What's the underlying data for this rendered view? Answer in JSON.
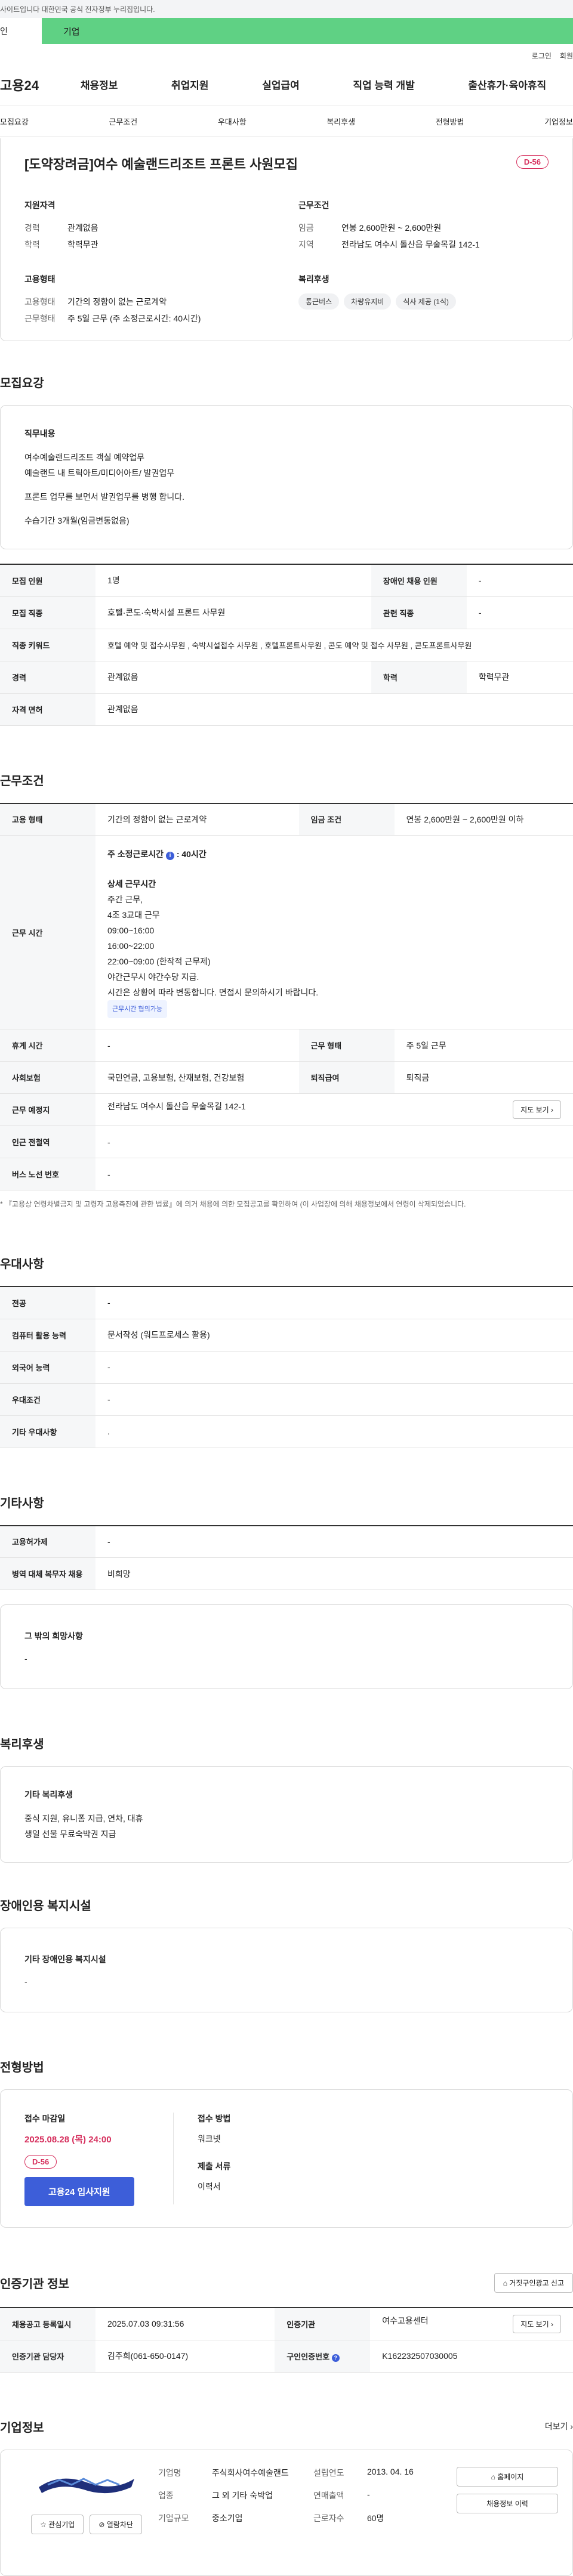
{
  "gov_bar": "사이트입니다 대한민국 공식 전자정부 누리집입니다.",
  "top_tabs": {
    "individual": "인",
    "company": "기업"
  },
  "util": {
    "login": "로그인",
    "join": "회원"
  },
  "logo": "고용24",
  "gnb": [
    "채용정보",
    "취업지원",
    "실업급여",
    "직업 능력 개발",
    "출산휴가·육아휴직"
  ],
  "subnav": [
    "모집요강",
    "근무조건",
    "우대사항",
    "복리후생",
    "전형방법",
    "기업정보"
  ],
  "summary": {
    "title": "[도약장려금]여수 예술랜드리조트 프론트 사원모집",
    "dday": "D-56",
    "qualification": {
      "title": "지원자격",
      "career_k": "경력",
      "career_v": "관계없음",
      "edu_k": "학력",
      "edu_v": "학력무관"
    },
    "condition": {
      "title": "근무조건",
      "wage_k": "임금",
      "wage_v": "연봉 2,600만원 ~ 2,600만원",
      "place_k": "지역",
      "place_v": "전라남도 여수시 돌산읍 무술목길 142-1"
    },
    "employment": {
      "title": "고용형태",
      "type_k": "고용형태",
      "type_v": "기간의 정함이 없는 근로계약",
      "hours_k": "근무형태",
      "hours_v": "주 5일 근무 (주 소정근로시간: 40시간)"
    },
    "welfare": {
      "title": "복리후생",
      "chips": [
        "통근버스",
        "차량유지비",
        "식사 제공 (1식)"
      ]
    }
  },
  "recruit": {
    "title": "모집요강",
    "duty_title": "직무내용",
    "duty_lines": [
      "여수예술랜드리조트 객실 예약업무",
      "예술랜드 내 트릭아트/미디어아트/ 발권업무",
      "",
      "프론트 업무를 보면서 발권업무를 병행 합니다.",
      "",
      "수습기간 3개월(임금변동없음)"
    ],
    "rows": [
      {
        "k1": "모집 인원",
        "v1": "1명",
        "k2": "장애인 채용 인원",
        "v2": "-"
      },
      {
        "k1": "모집 직종",
        "v1": "호텔·콘도·숙박시설 프론트 사무원",
        "k2": "관련 직종",
        "v2": "-"
      },
      {
        "k1": "직종 키워드",
        "v1": "호텔 예약 및 접수사무원 , 숙박시설접수 사무원 , 호텔프론트사무원 , 콘도 예약 및 접수 사무원 , 콘도프론트사무원",
        "k2": "",
        "v2": ""
      },
      {
        "k1": "경력",
        "v1": "관계없음",
        "k2": "학력",
        "v2": "학력무관"
      },
      {
        "k1": "자격 면허",
        "v1": "관계없음",
        "k2": "",
        "v2": ""
      }
    ]
  },
  "work": {
    "title": "근무조건",
    "emp_k": "고용 형태",
    "emp_v": "기간의 정함이 없는 근로계약",
    "wage_k": "임금 조건",
    "wage_v": "연봉 2,600만원 ~ 2,600만원 이하",
    "time_k": "근무 시간",
    "time_head": "주 소정근로시간",
    "time_hours": ": 40시간",
    "time_detail_title": "상세 근무시간",
    "time_lines": [
      "주간 근무,",
      "4조 3교대 근무",
      "09:00~16:00",
      "16:00~22:00",
      "22:00~09:00 (한작적 근무제)",
      "야간근무시 야간수당 지급.",
      "시간은 상황에 따라 변동합니다. 면접시 문의하시기 바랍니다."
    ],
    "time_badge": "근무시간 협의가능",
    "break_k": "휴게 시간",
    "break_v": "-",
    "shift_k": "근무 형태",
    "shift_v": "주 5일 근무",
    "ins_k": "사회보험",
    "ins_v": "국민연금, 고용보험, 산재보험, 건강보험",
    "ret_k": "퇴직급여",
    "ret_v": "퇴직금",
    "place_k": "근무 예정지",
    "place_v": "전라남도 여수시 돌산읍 무술목길 142-1",
    "map_btn": "지도 보기",
    "subway_k": "인근 전철역",
    "subway_v": "-",
    "bus_k": "버스 노선 번호",
    "bus_v": "-",
    "note": "* 『고용상 연령차별금지 및 고령자 고용촉진에 관한 법률』에 의거 채용에 의한 모집공고를 확인하여 (이 사업장에 의해 채용정보에서 연령이 삭제되었습니다."
  },
  "pref": {
    "title": "우대사항",
    "rows": [
      {
        "k": "전공",
        "v": "-"
      },
      {
        "k": "컴퓨터 활용 능력",
        "v": "문서작성 (워드프로세스 활용)"
      },
      {
        "k": "외국어 능력",
        "v": "-"
      },
      {
        "k": "우대조건",
        "v": "-"
      },
      {
        "k": "기타 우대사항",
        "v": "."
      }
    ]
  },
  "etc": {
    "title": "기타사항",
    "rows": [
      {
        "k": "고용허가제",
        "v": "-"
      },
      {
        "k": "병역 대체 복무자 채용",
        "v": "비희망"
      }
    ],
    "other_title": "그 밖의 희망사항",
    "other_v": "-"
  },
  "welfare": {
    "title": "복리후생",
    "sub": "기타 복리후생",
    "lines": [
      "중식 지원, 유니폼 지급, 연차, 대휴",
      "생일 선물 무료숙박권 지급"
    ]
  },
  "disabled": {
    "title": "장애인용 복지시설",
    "sub": "기타 장애인용 복지시설",
    "v": "-"
  },
  "process": {
    "title": "전형방법",
    "deadline_title": "접수 마감일",
    "deadline": "2025.08.28 (목) 24:00",
    "dday": "D-56",
    "apply_btn": "고용24 입사지원",
    "method_title": "접수 방법",
    "method_v": "워크넷",
    "docs_title": "제출 서류",
    "docs_v": "이력서"
  },
  "cert": {
    "title": "인증기관 정보",
    "report_btn": "거짓구인광고 신고",
    "rows": [
      {
        "k1": "채용공고 등록일시",
        "v1": "2025.07.03 09:31:56",
        "k2": "인증기관",
        "v2": "여수고용센터"
      },
      {
        "k1": "인증기관 담당자",
        "v1": "김주희(061-650-0147)",
        "k2": "구인인증번호",
        "v2": "K162232507030005"
      }
    ],
    "map_btn": "지도 보기"
  },
  "corp": {
    "title": "기업정보",
    "more": "더보기",
    "fav_btn": "관심기업",
    "block_btn": "열람차단",
    "name_k": "기업명",
    "name_v": "주식회사여수예술랜드",
    "industry_k": "업종",
    "industry_v": "그 외 기타 숙박업",
    "size_k": "기업규모",
    "size_v": "중소기업",
    "founded_k": "설립연도",
    "founded_v": "2013. 04. 16",
    "sales_k": "연매출액",
    "sales_v": "-",
    "staff_k": "근로자수",
    "staff_v": "60명",
    "home_btn": "홈페이지",
    "jobs_btn": "채용정보 이력"
  }
}
